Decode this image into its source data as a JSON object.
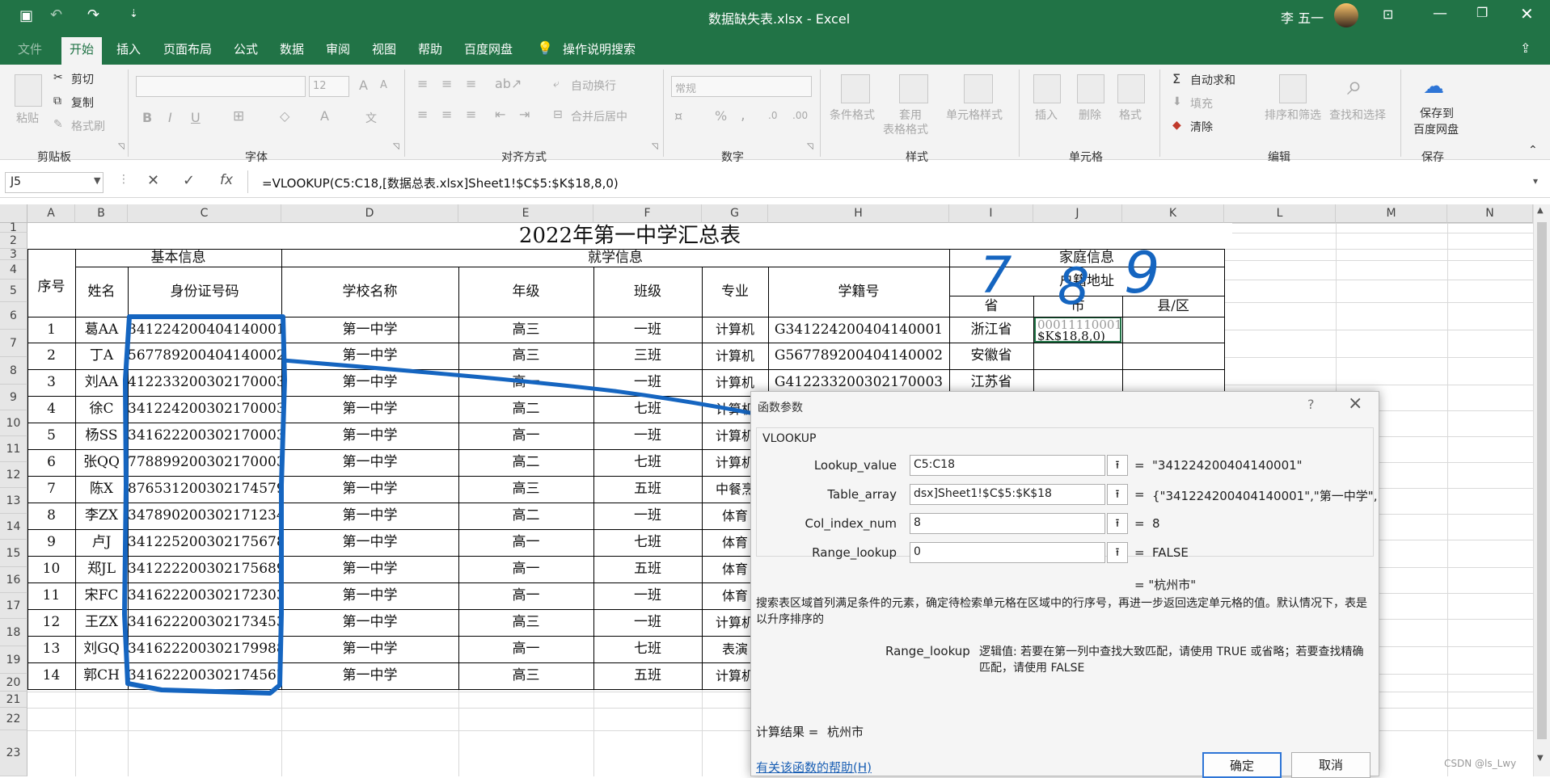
{
  "window": {
    "title": "数据缺失表.xlsx  -  Excel",
    "user": "李 五一"
  },
  "tabs": [
    "文件",
    "开始",
    "插入",
    "页面布局",
    "公式",
    "数据",
    "审阅",
    "视图",
    "帮助",
    "百度网盘",
    "操作说明搜索"
  ],
  "ribbon": {
    "clipboard": {
      "group": "剪贴板",
      "paste": "粘贴",
      "cut": "剪切",
      "copy": "复制",
      "format_painter": "格式刷"
    },
    "font": {
      "group": "字体",
      "size": "12",
      "bold": "B",
      "italic": "I",
      "underline": "U",
      "grow": "A",
      "shrink": "A",
      "wen": "文",
      "color_a": "A"
    },
    "align": {
      "group": "对齐方式",
      "wrap": "自动换行",
      "merge": "合并后居中"
    },
    "number": {
      "group": "数字",
      "format": "常规",
      "percent": "%",
      "comma": ","
    },
    "styles": {
      "group": "样式",
      "conditional": "条件格式",
      "table_line1": "套用",
      "table_line2": "表格格式",
      "cell_styles": "单元格样式"
    },
    "cells": {
      "group": "单元格",
      "insert": "插入",
      "delete": "删除",
      "format": "格式"
    },
    "edit": {
      "group": "编辑",
      "autosum": "自动求和",
      "fill": "填充",
      "clear": "清除",
      "sort": "排序和筛选",
      "find": "查找和选择"
    },
    "save": {
      "group": "保存",
      "line1": "保存到",
      "line2": "百度网盘"
    }
  },
  "formula_bar": {
    "name_box": "J5",
    "fx": "fx",
    "formula": "=VLOOKUP(C5:C18,[数据总表.xlsx]Sheet1!$C$5:$K$18,8,0)"
  },
  "columns": [
    "A",
    "B",
    "C",
    "D",
    "E",
    "F",
    "G",
    "H",
    "I",
    "J",
    "K",
    "L",
    "M",
    "N"
  ],
  "rows": [
    "1",
    "2",
    "3",
    "4",
    "5",
    "6",
    "7",
    "8",
    "9",
    "10",
    "11",
    "12",
    "13",
    "14",
    "15",
    "16",
    "17",
    "18",
    "19",
    "20",
    "21",
    "22",
    "23"
  ],
  "sheet": {
    "title": "2022年第一中学汇总表",
    "headers": {
      "seq": "序号",
      "basic": "基本信息",
      "name": "姓名",
      "id": "身份证号码",
      "study": "就学信息",
      "school": "学校名称",
      "grade": "年级",
      "class": "班级",
      "major": "专业",
      "student_no": "学籍号",
      "family": "家庭信息",
      "hukou": "户籍地址",
      "province": "省",
      "city": "市",
      "county": "县/区"
    },
    "j5_text": [
      "00011110001",
      "$K$18,8,0)"
    ],
    "rows": [
      [
        "1",
        "葛AA",
        "341224200404140001",
        "第一中学",
        "高三",
        "一班",
        "计算机",
        "G341224200404140001",
        "浙江省"
      ],
      [
        "2",
        "丁A",
        "567789200404140002",
        "第一中学",
        "高三",
        "三班",
        "计算机",
        "G567789200404140002",
        "安徽省"
      ],
      [
        "3",
        "刘AA",
        "412233200302170003",
        "第一中学",
        "高一",
        "一班",
        "计算机",
        "G412233200302170003",
        "江苏省"
      ],
      [
        "4",
        "徐C",
        "341224200302170003",
        "第一中学",
        "高二",
        "七班",
        "计算机",
        "",
        ""
      ],
      [
        "5",
        "杨SS",
        "341622200302170003",
        "第一中学",
        "高一",
        "一班",
        "计算机",
        "",
        ""
      ],
      [
        "6",
        "张QQ",
        "778899200302170003",
        "第一中学",
        "高二",
        "七班",
        "计算机",
        "",
        ""
      ],
      [
        "7",
        "陈X",
        "876531200302174579",
        "第一中学",
        "高三",
        "五班",
        "中餐烹",
        "",
        ""
      ],
      [
        "8",
        "李ZX",
        "347890200302171234",
        "第一中学",
        "高二",
        "一班",
        "体育",
        "",
        ""
      ],
      [
        "9",
        "卢J",
        "341225200302175678",
        "第一中学",
        "高一",
        "七班",
        "体育",
        "",
        ""
      ],
      [
        "10",
        "郑JL",
        "341222200302175689",
        "第一中学",
        "高一",
        "五班",
        "体育",
        "",
        ""
      ],
      [
        "11",
        "宋FC",
        "341622200302172303",
        "第一中学",
        "高一",
        "一班",
        "体育",
        "",
        ""
      ],
      [
        "12",
        "王ZX",
        "341622200302173453",
        "第一中学",
        "高三",
        "一班",
        "计算机",
        "",
        ""
      ],
      [
        "13",
        "刘GQ",
        "341622200302179988",
        "第一中学",
        "高一",
        "七班",
        "表演",
        "",
        ""
      ],
      [
        "14",
        "郭CH",
        "341622200302174567",
        "第一中学",
        "高三",
        "五班",
        "计算机",
        "",
        ""
      ]
    ]
  },
  "annotations": {
    "n7": "7",
    "n8": "8",
    "n9": "9"
  },
  "dialog": {
    "title": "函数参数",
    "help_q": "?",
    "close": "×",
    "function": "VLOOKUP",
    "args": [
      {
        "label": "Lookup_value",
        "value": "C5:C18",
        "result": "\"341224200404140001\""
      },
      {
        "label": "Table_array",
        "value": "dsx]Sheet1!$C$5:$K$18",
        "result": "{\"341224200404140001\",\"第一中学\","
      },
      {
        "label": "Col_index_num",
        "value": "8",
        "result": "8"
      },
      {
        "label": "Range_lookup",
        "value": "0",
        "result": "FALSE"
      }
    ],
    "eq": "=",
    "overall": "= \"杭州市\"",
    "description": "搜索表区域首列满足条件的元素，确定待检索单元格在区域中的行序号，再进一步返回选定单元格的值。默认情况下，表是以升序排序的",
    "arg_help_name": "Range_lookup",
    "arg_help_text": "逻辑值: 若要在第一列中查找大致匹配，请使用 TRUE 或省略；若要查找精确匹配，请使用 FALSE",
    "result_label": "计算结果 =",
    "result_value": "杭州市",
    "help_link": "有关该函数的帮助(H)",
    "ok": "确定",
    "cancel": "取消"
  },
  "watermark": "CSDN @ls_Lwy"
}
